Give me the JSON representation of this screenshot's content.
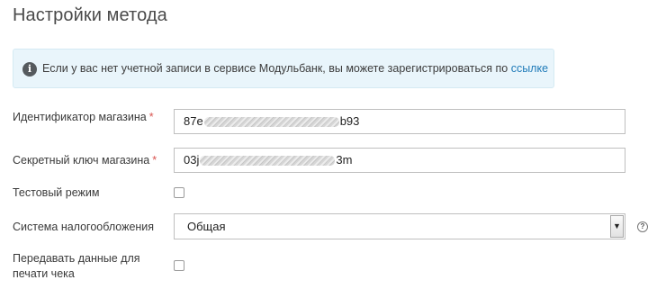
{
  "page": {
    "title": "Настройки метода"
  },
  "info": {
    "icon": "info-icon",
    "text": "Если у вас нет учетной записи в сервисе Модульбанк, вы можете зарегистрироваться по ",
    "link_text": "ссылке"
  },
  "fields": {
    "shop_id": {
      "label": "Идентификатор магазина",
      "required_mark": "*",
      "value_start": "87e",
      "value_end": "b93"
    },
    "secret_key": {
      "label": "Секретный ключ магазина",
      "required_mark": "*",
      "value_start": "03j",
      "value_end": "3m"
    },
    "test_mode": {
      "label": "Тестовый режим",
      "checked": false
    },
    "tax_system": {
      "label": "Система налогообложения",
      "selected": "Общая",
      "help_icon": "question-circle-icon"
    },
    "send_receipt": {
      "label": "Передавать данные для печати чека",
      "checked": false
    }
  }
}
